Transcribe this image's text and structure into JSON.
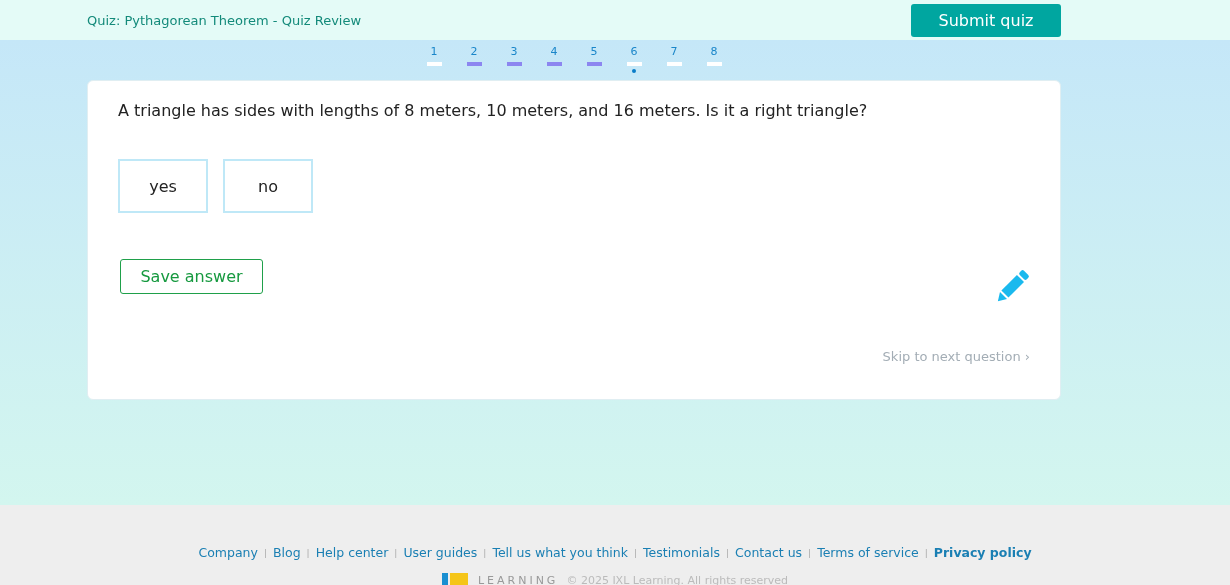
{
  "header": {
    "title": "Quiz: Pythagorean Theorem - Quiz Review",
    "submit_button": "Submit quiz"
  },
  "questions": [
    {
      "label": "1",
      "answered": false,
      "selected": false
    },
    {
      "label": "2",
      "answered": true,
      "selected": false
    },
    {
      "label": "3",
      "answered": true,
      "selected": false
    },
    {
      "label": "4",
      "answered": true,
      "selected": false
    },
    {
      "label": "5",
      "answered": true,
      "selected": false
    },
    {
      "label": "6",
      "answered": false,
      "selected": true
    },
    {
      "label": "7",
      "answered": false,
      "selected": false
    },
    {
      "label": "8",
      "answered": false,
      "selected": false
    }
  ],
  "question": {
    "prompt": "A triangle has sides with lengths of 8 meters, 10 meters, and 16 meters. Is it a right triangle?",
    "choices": [
      {
        "label": "yes",
        "selected": false
      },
      {
        "label": "no",
        "selected": false
      }
    ],
    "save_button": "Save answer",
    "skip_link": "Skip to next question ›"
  },
  "footer": {
    "links": [
      {
        "label": "Company",
        "bold": false
      },
      {
        "label": "Blog",
        "bold": false
      },
      {
        "label": "Help center",
        "bold": false
      },
      {
        "label": "User guides",
        "bold": false
      },
      {
        "label": "Tell us what you think",
        "bold": false
      },
      {
        "label": "Testimonials",
        "bold": false
      },
      {
        "label": "Contact us",
        "bold": false
      },
      {
        "label": "Terms of service",
        "bold": false
      },
      {
        "label": "Privacy policy",
        "bold": true
      }
    ],
    "separator": "|",
    "logo_text": "LEARNING",
    "copyright": "© 2025 IXL Learning. All rights reserved"
  }
}
